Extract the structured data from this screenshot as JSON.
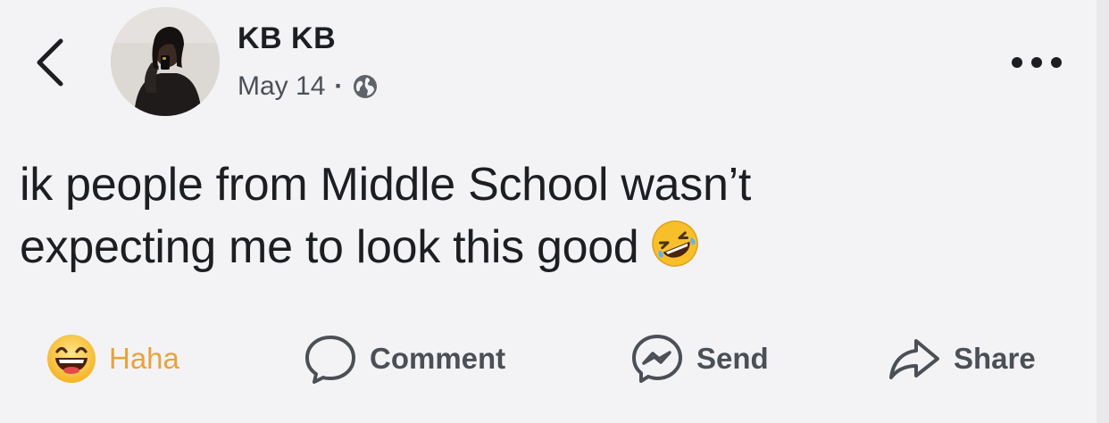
{
  "post": {
    "author": "KB KB",
    "date": "May 14",
    "separator": "·",
    "text_lines": [
      "ik people from Middle School wasn’t",
      "expecting me to look this good"
    ]
  },
  "actions": {
    "reaction_label": "Haha",
    "comment_label": "Comment",
    "send_label": "Send",
    "share_label": "Share"
  },
  "icons": {
    "back": "back-chevron-icon",
    "globe": "globe-icon",
    "more": "more-dots-icon",
    "post_emoji": "rolling-laughing-emoji-icon",
    "haha": "haha-reaction-icon",
    "comment": "comment-bubble-icon",
    "send": "messenger-icon",
    "share": "share-arrow-icon"
  },
  "colors": {
    "background": "#f3f3f5",
    "text": "#1c1e21",
    "secondary_text": "#4b4f56",
    "haha_active": "#e8a33b"
  }
}
